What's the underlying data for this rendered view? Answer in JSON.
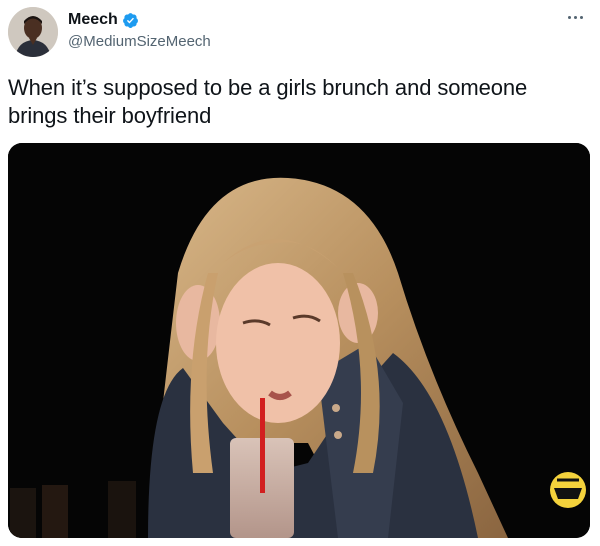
{
  "tweet": {
    "author": {
      "display_name": "Meech",
      "handle": "@MediumSizeMeech",
      "verified": true,
      "avatar_icon": "person-avatar"
    },
    "text": "When it’s supposed to be a girls brunch and someone brings their boyfriend",
    "media": {
      "kind": "photo",
      "watermark_icon": "hot-ones-logo"
    },
    "more_icon": "ellipsis-icon"
  },
  "colors": {
    "verified": "#1d9bf0",
    "text_primary": "#0f1419",
    "text_secondary": "#536471",
    "media_background": "#000000"
  }
}
